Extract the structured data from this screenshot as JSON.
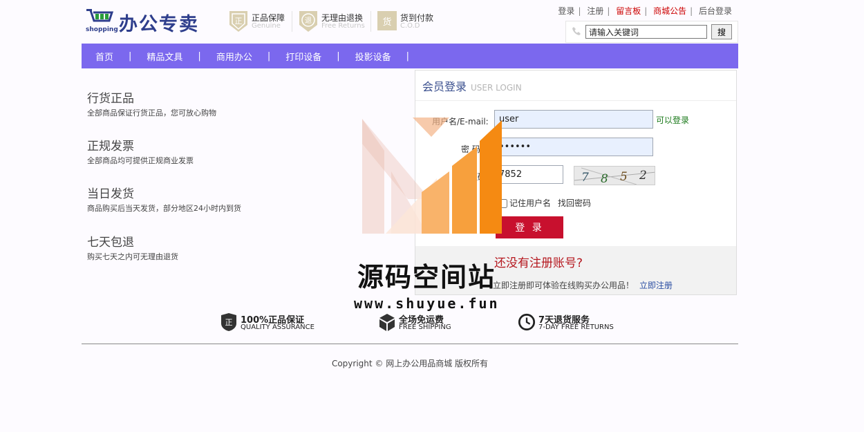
{
  "header": {
    "logo_text": "办公专卖",
    "logo_sub": "shopping",
    "promises": [
      {
        "title": "正品保障",
        "sub": "Genuine",
        "glyph": "正"
      },
      {
        "title": "无理由退换",
        "sub": "Free Returns",
        "glyph": "退"
      },
      {
        "title": "货到付款",
        "sub": "C.O.D",
        "glyph": "货"
      }
    ],
    "links": {
      "login": "登录",
      "register": "注册",
      "message_board": "留言板",
      "mall_notice": "商城公告",
      "admin_login": "后台登录"
    },
    "search": {
      "value": "请输入关键词",
      "button": "搜"
    }
  },
  "nav": {
    "items": [
      "首页",
      "精品文具",
      "商用办公",
      "打印设备",
      "投影设备"
    ]
  },
  "features": [
    {
      "title": "行货正品",
      "desc": "全部商品保证行货正品，您可放心购物"
    },
    {
      "title": "正规发票",
      "desc": "全部商品均可提供正规商业发票"
    },
    {
      "title": "当日发货",
      "desc": "商品购买后当天发货，部分地区24小时内到货"
    },
    {
      "title": "七天包退",
      "desc": "购买七天之内可无理由退货"
    }
  ],
  "login": {
    "title_cn": "会员登录",
    "title_en": "USER LOGIN",
    "username_label": "用户名/E-mail:",
    "username_value": "user",
    "username_ok": "可以登录",
    "password_label": "密  码:",
    "password_value": "••••••",
    "captcha_label": "验证码:",
    "captcha_value": "7852",
    "captcha_image_text": "7852",
    "remember": "记住用户名",
    "find_password": "找回密码",
    "submit": "登 录",
    "register_title": "还没有注册账号?",
    "register_desc": "立即注册即可体验在线购买办公用品！",
    "register_link": "立即注册"
  },
  "watermark": {
    "text": "源码空间站",
    "url": "www.shuyue.fun"
  },
  "services": [
    {
      "cn": "100%正品保证",
      "en": "QUALITY ASSURANCE",
      "icon": "shield-icon"
    },
    {
      "cn": "全场免运费",
      "en": "FREE SHIPPING",
      "icon": "box-icon"
    },
    {
      "cn": "7天退货服务",
      "en": "7-DAY FREE RETURNS",
      "icon": "clock-icon"
    }
  ],
  "footer": {
    "copyright": "Copyright © 网上办公用品商城 版权所有"
  },
  "colors": {
    "nav": "#7b68ee",
    "login_button": "#c8102e",
    "brand": "#2e3e8c"
  }
}
